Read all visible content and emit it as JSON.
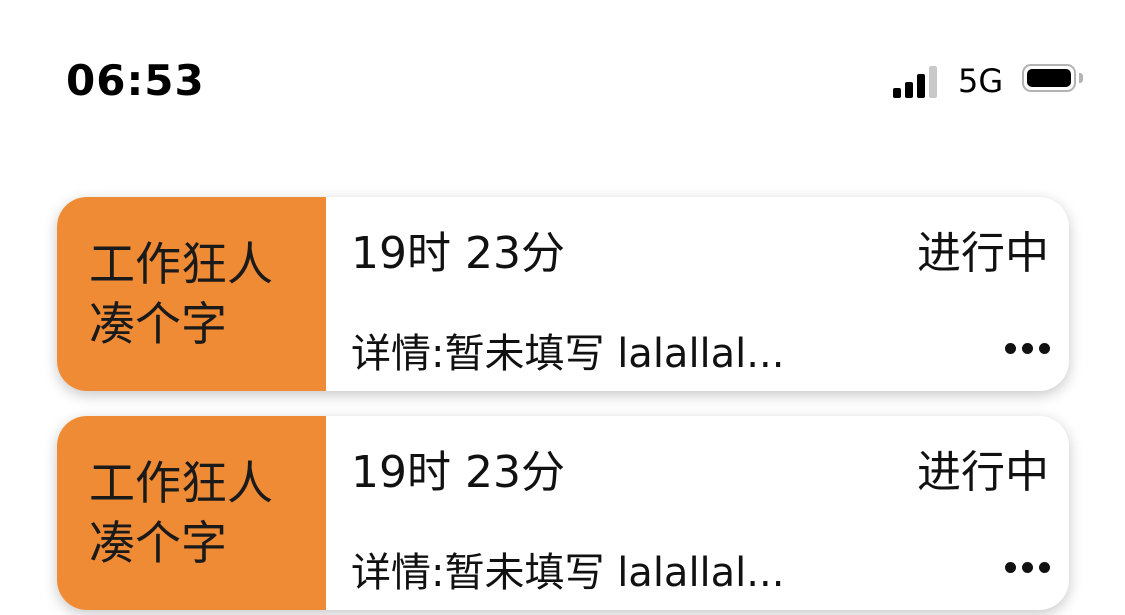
{
  "status_bar": {
    "time": "06:53",
    "network": "5G",
    "signal_icon": "cellular-signal-icon",
    "battery_icon": "battery-icon",
    "signal_strength": "3/4",
    "battery_level": 0.9
  },
  "colors": {
    "tag_background": "#ef8a35",
    "card_background": "#ffffff",
    "text": "#111111"
  },
  "tasks": [
    {
      "tag": "工作狂人凑个字",
      "duration": "19时 23分",
      "status": "进行中",
      "detail": "详情:暂未填写 lalallal...",
      "more_icon": "ellipsis-icon"
    },
    {
      "tag": "工作狂人凑个字",
      "duration": "19时 23分",
      "status": "进行中",
      "detail": "详情:暂未填写 lalallal...",
      "more_icon": "ellipsis-icon"
    }
  ]
}
